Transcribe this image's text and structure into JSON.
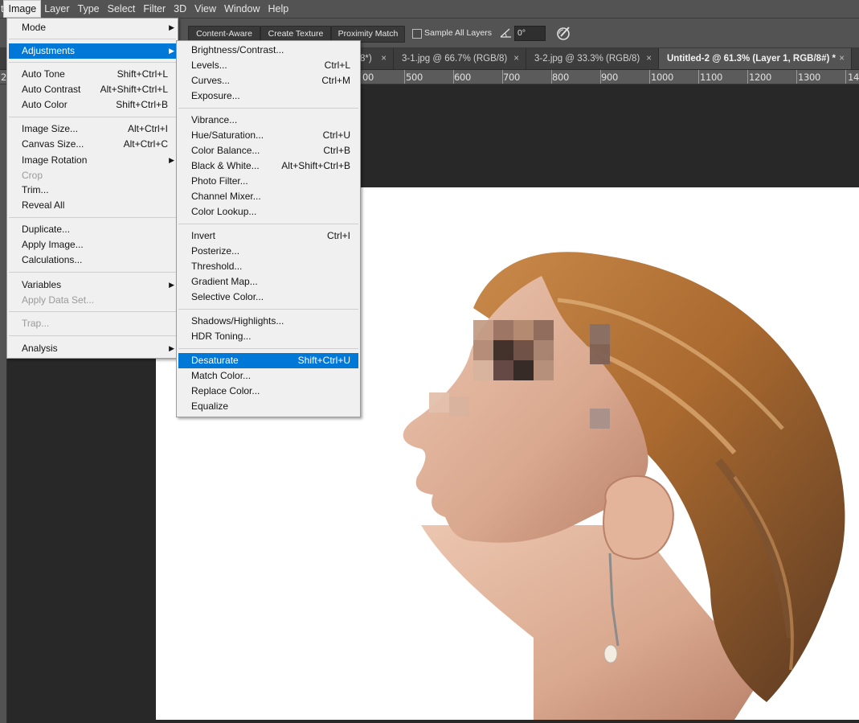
{
  "menubar": {
    "edge": "t",
    "items": [
      "Image",
      "Layer",
      "Type",
      "Select",
      "Filter",
      "3D",
      "View",
      "Window",
      "Help"
    ],
    "active": "Image"
  },
  "options": {
    "content_aware": "Content-Aware",
    "create_texture": "Create Texture",
    "proximity_match": "Proximity Match",
    "sample_all_layers": "Sample All Layers",
    "angle_value": "0°"
  },
  "tabs": [
    {
      "label": "8*)",
      "active": false
    },
    {
      "label": "3-1.jpg @ 66.7% (RGB/8)",
      "active": false
    },
    {
      "label": "3-2.jpg @ 33.3% (RGB/8)",
      "active": false
    },
    {
      "label": "Untitled-2 @ 61.3% (Layer 1, RGB/8#) *",
      "active": true
    }
  ],
  "tab_close": "×",
  "ruler": {
    "left_label": "2",
    "labels": [
      "00",
      "500",
      "600",
      "700",
      "800",
      "900",
      "1000",
      "1100",
      "1200",
      "1300",
      "14"
    ]
  },
  "image_menu": [
    {
      "label": "Mode",
      "shortcut": "",
      "submenu": true
    },
    {
      "label": "Adjustments",
      "shortcut": "",
      "submenu": true,
      "selected": true
    },
    {
      "label": "Auto Tone",
      "shortcut": "Shift+Ctrl+L"
    },
    {
      "label": "Auto Contrast",
      "shortcut": "Alt+Shift+Ctrl+L"
    },
    {
      "label": "Auto Color",
      "shortcut": "Shift+Ctrl+B"
    },
    {
      "label": "Image Size...",
      "shortcut": "Alt+Ctrl+I"
    },
    {
      "label": "Canvas Size...",
      "shortcut": "Alt+Ctrl+C"
    },
    {
      "label": "Image Rotation",
      "shortcut": "",
      "submenu": true
    },
    {
      "label": "Crop",
      "shortcut": "",
      "disabled": true
    },
    {
      "label": "Trim...",
      "shortcut": ""
    },
    {
      "label": "Reveal All",
      "shortcut": ""
    },
    {
      "label": "Duplicate...",
      "shortcut": ""
    },
    {
      "label": "Apply Image...",
      "shortcut": ""
    },
    {
      "label": "Calculations...",
      "shortcut": ""
    },
    {
      "label": "Variables",
      "shortcut": "",
      "submenu": true
    },
    {
      "label": "Apply Data Set...",
      "shortcut": "",
      "disabled": true
    },
    {
      "label": "Trap...",
      "shortcut": "",
      "disabled": true
    },
    {
      "label": "Analysis",
      "shortcut": "",
      "submenu": true
    }
  ],
  "adjustments_menu": [
    {
      "label": "Brightness/Contrast...",
      "shortcut": ""
    },
    {
      "label": "Levels...",
      "shortcut": "Ctrl+L"
    },
    {
      "label": "Curves...",
      "shortcut": "Ctrl+M"
    },
    {
      "label": "Exposure...",
      "shortcut": ""
    },
    {
      "label": "Vibrance...",
      "shortcut": ""
    },
    {
      "label": "Hue/Saturation...",
      "shortcut": "Ctrl+U"
    },
    {
      "label": "Color Balance...",
      "shortcut": "Ctrl+B"
    },
    {
      "label": "Black & White...",
      "shortcut": "Alt+Shift+Ctrl+B"
    },
    {
      "label": "Photo Filter...",
      "shortcut": ""
    },
    {
      "label": "Channel Mixer...",
      "shortcut": ""
    },
    {
      "label": "Color Lookup...",
      "shortcut": ""
    },
    {
      "label": "Invert",
      "shortcut": "Ctrl+I"
    },
    {
      "label": "Posterize...",
      "shortcut": ""
    },
    {
      "label": "Threshold...",
      "shortcut": ""
    },
    {
      "label": "Gradient Map...",
      "shortcut": ""
    },
    {
      "label": "Selective Color...",
      "shortcut": ""
    },
    {
      "label": "Shadows/Highlights...",
      "shortcut": ""
    },
    {
      "label": "HDR Toning...",
      "shortcut": ""
    },
    {
      "label": "Desaturate",
      "shortcut": "Shift+Ctrl+U",
      "selected": true
    },
    {
      "label": "Match Color...",
      "shortcut": ""
    },
    {
      "label": "Replace Color...",
      "shortcut": ""
    },
    {
      "label": "Equalize",
      "shortcut": ""
    }
  ],
  "colors": {
    "menu_bg": "#f0f0f0",
    "highlight": "#0078d7",
    "chrome": "#535353",
    "workspace": "#282828"
  }
}
